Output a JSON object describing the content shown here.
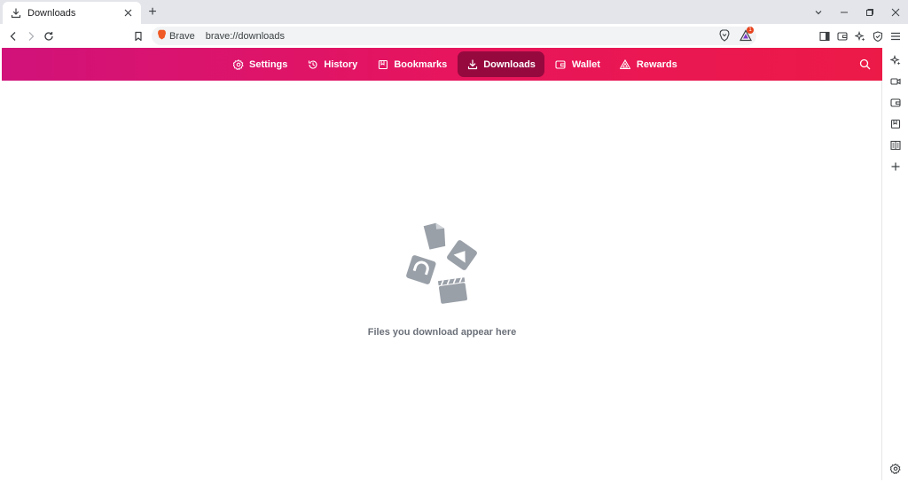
{
  "tab": {
    "title": "Downloads",
    "close": "✕"
  },
  "newtab": {
    "label": "+"
  },
  "omnibox": {
    "brand": "Brave",
    "url": "brave://downloads",
    "rewards_badge": "1"
  },
  "navbar": {
    "items": [
      {
        "label": "Settings",
        "icon": "gear-icon"
      },
      {
        "label": "History",
        "icon": "history-icon"
      },
      {
        "label": "Bookmarks",
        "icon": "bookmark-icon"
      },
      {
        "label": "Downloads",
        "icon": "download-icon",
        "active": true
      },
      {
        "label": "Wallet",
        "icon": "wallet-icon"
      },
      {
        "label": "Rewards",
        "icon": "rewards-icon"
      }
    ]
  },
  "empty_state": {
    "message": "Files you download appear here"
  },
  "colors": {
    "accent_start": "#d1127a",
    "accent_end": "#ec1a47",
    "active_bg": "#96093f",
    "illustration": "#9aa0a8"
  }
}
